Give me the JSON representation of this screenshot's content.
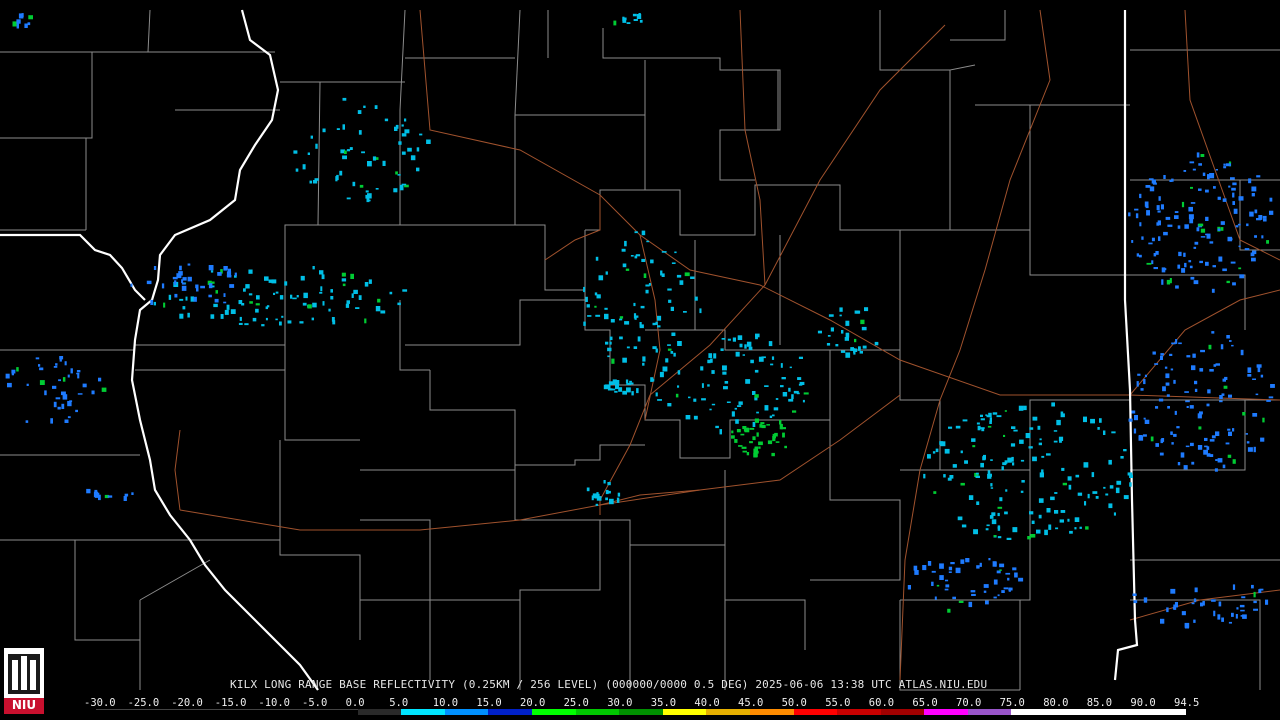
{
  "caption": "KILX LONG RANGE BASE REFLECTIVITY (0.25KM / 256 LEVEL) (000000/0000 0.5 DEG) 2025-06-06 13:38 UTC  ATLAS.NIU.EDU",
  "logo_text": "NIU",
  "scale": {
    "labels": [
      "-30.0",
      "-25.0",
      "-20.0",
      "-15.0",
      "-10.0",
      "-5.0",
      "0.0",
      "5.0",
      "10.0",
      "15.0",
      "20.0",
      "25.0",
      "30.0",
      "35.0",
      "40.0",
      "45.0",
      "50.0",
      "55.0",
      "60.0",
      "65.0",
      "70.0",
      "75.0",
      "80.0",
      "85.0",
      "90.0",
      "94.5"
    ],
    "colors": [
      "#000000",
      "#000000",
      "#000000",
      "#000000",
      "#000000",
      "#000000",
      "#2a2a2a",
      "#00e5ff",
      "#0090ff",
      "#0020c8",
      "#00ff00",
      "#00c800",
      "#009000",
      "#ffff00",
      "#e6b000",
      "#ff8c00",
      "#ff0000",
      "#c80000",
      "#a00000",
      "#ff00ff",
      "#9955c9",
      "#ffffff",
      "#ffffff",
      "#ffffff",
      "#ffffff"
    ]
  },
  "colors": {
    "county_lines": "#8c8c8c",
    "state_lines": "#ffffff",
    "highways": "#a0522d",
    "echo_light": "#00bfe6",
    "echo_blue": "#1e7bff",
    "echo_green": "#00cc33"
  }
}
